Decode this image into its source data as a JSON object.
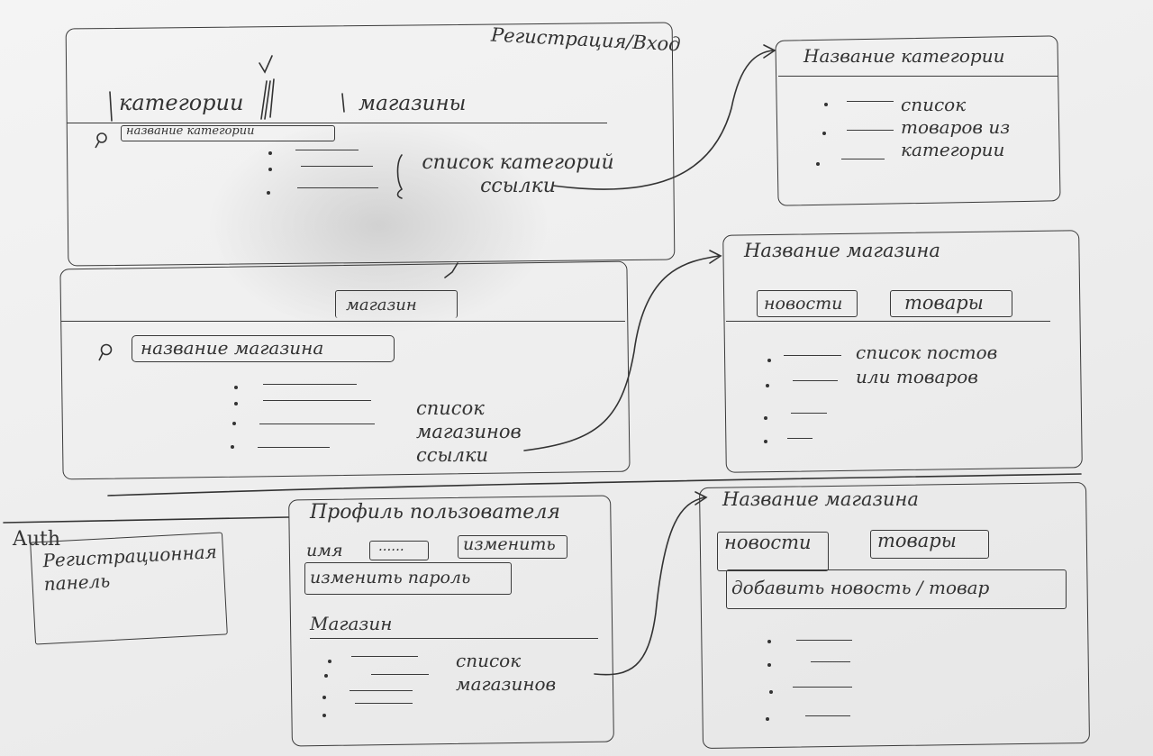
{
  "categories_screen": {
    "auth_link": "Регистрация/Вход",
    "tab_categories": "категории",
    "tab_shops": "магазины",
    "search_placeholder": "название категории",
    "list_note": "список категорий ссылки"
  },
  "category_detail": {
    "title": "Название категории",
    "list_note": "список товаров из категории"
  },
  "shops_screen": {
    "tab_shops": "магазин",
    "search_placeholder": "название магазина",
    "list_note": "список магазинов ссылки"
  },
  "shop_detail": {
    "title": "Название магазина",
    "tab_news": "новости",
    "tab_products": "товары",
    "list_note": "список постов или товаров"
  },
  "auth": {
    "heading": "Auth",
    "panel_text": "Регистрационная панель"
  },
  "profile": {
    "title": "Профиль пользователя",
    "name_label": "имя",
    "name_value": "......",
    "change_button": "изменить",
    "change_password_button": "изменить пароль",
    "shops_heading": "Магазин",
    "list_note": "список магазинов"
  },
  "owner_shop": {
    "title": "Название магазина",
    "tab_news": "новости",
    "tab_products": "товары",
    "add_button": "добавить новость / товар"
  }
}
